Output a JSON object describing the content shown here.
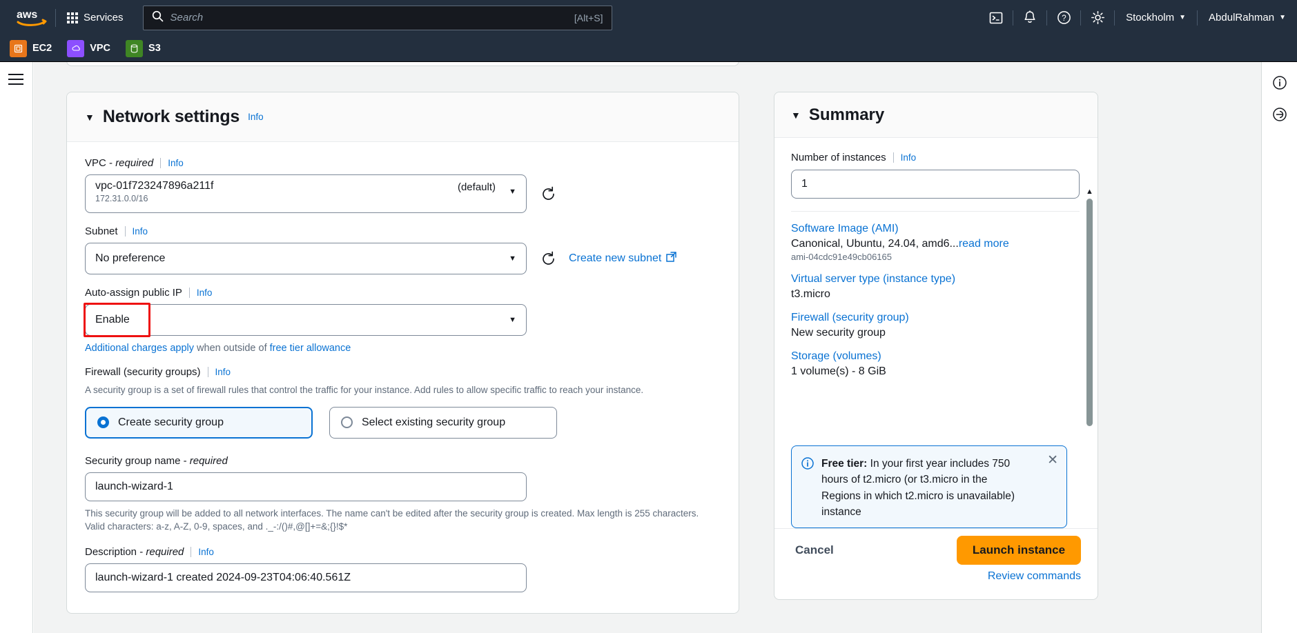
{
  "topnav": {
    "logo_alt": "aws",
    "services_label": "Services",
    "search_placeholder": "Search",
    "search_value": "",
    "search_hint": "[Alt+S]",
    "cloudshell_icon": "cloudshell-icon",
    "notifications_icon": "bell-icon",
    "help_icon": "question-circle-icon",
    "settings_icon": "gear-icon",
    "region": "Stockholm",
    "account": "AbdulRahman",
    "caret": "▼"
  },
  "shortcuts": [
    {
      "label": "EC2",
      "color": "#e8761b",
      "icon": "ec2-icon"
    },
    {
      "label": "VPC",
      "color": "#8c4fff",
      "icon": "vpc-icon"
    },
    {
      "label": "S3",
      "color": "#3f8624",
      "icon": "s3-icon"
    }
  ],
  "left_rail": {
    "menu_icon": "hamburger-menu-icon"
  },
  "right_rail": {
    "info_icon": "info-panel-icon",
    "shortcuts_icon": "shortcuts-panel-icon"
  },
  "network_settings": {
    "title": "Network settings",
    "info_label": "Info",
    "collapse_caret": "▼",
    "vpc": {
      "label": "VPC - ",
      "label_required": "required",
      "info_label": "Info",
      "value": "vpc-01f723247896a211f",
      "suffix": "(default)",
      "cidr": "172.31.0.0/16",
      "refresh_icon": "refresh-icon"
    },
    "subnet": {
      "label": "Subnet",
      "info_label": "Info",
      "value": "No preference",
      "refresh_icon": "refresh-icon",
      "create_link": "Create new subnet",
      "external_icon": "external-link-icon"
    },
    "auto_assign_ip": {
      "label": "Auto-assign public IP",
      "info_label": "Info",
      "value": "Enable",
      "highlighted": true,
      "highlight_color": "#ee1111",
      "charges_link": "Additional charges apply",
      "charges_middle": " when outside of ",
      "charges_link2": "free tier allowance"
    },
    "firewall": {
      "label": "Firewall (security groups)",
      "info_label": "Info",
      "description": "A security group is a set of firewall rules that control the traffic for your instance. Add rules to allow specific traffic to reach your instance.",
      "options": [
        {
          "label": "Create security group",
          "selected": true
        },
        {
          "label": "Select existing security group",
          "selected": false
        }
      ]
    },
    "security_group_name": {
      "label": "Security group name - ",
      "label_required": "required",
      "value": "launch-wizard-1",
      "helper": "This security group will be added to all network interfaces. The name can't be edited after the security group is created. Max length is 255 characters. Valid characters: a-z, A-Z, 0-9, spaces, and ._-:/()#,@[]+=&;{}!$*"
    },
    "description": {
      "label": "Description - ",
      "label_required": "required",
      "info_label": "Info",
      "value": "launch-wizard-1 created 2024-09-23T04:06:40.561Z"
    }
  },
  "summary": {
    "title": "Summary",
    "collapse_caret": "▼",
    "number_of_instances": {
      "label": "Number of instances",
      "info_label": "Info",
      "value": "1"
    },
    "items": [
      {
        "link": "Software Image (AMI)",
        "value": "Canonical, Ubuntu, 24.04, amd6...",
        "value_link": "read more",
        "sub": "ami-04cdc91e49cb06165"
      },
      {
        "link": "Virtual server type (instance type)",
        "value": "t3.micro",
        "value_link": "",
        "sub": ""
      },
      {
        "link": "Firewall (security group)",
        "value": "New security group",
        "value_link": "",
        "sub": ""
      },
      {
        "link": "Storage (volumes)",
        "value": "1 volume(s) - 8 GiB",
        "value_link": "",
        "sub": ""
      }
    ],
    "free_tier": {
      "icon": "info-circle-icon",
      "title": "Free tier:",
      "body": " In your first year includes 750 hours of t2.micro (or t3.micro in the Regions in which t2.micro is unavailable) instance",
      "close_icon": "close-icon"
    },
    "footer": {
      "cancel_label": "Cancel",
      "launch_label": "Launch instance",
      "launch_color": "#ff9900",
      "review_label": "Review commands"
    },
    "scroll_up_icon": "scroll-up-arrow",
    "scroll_down_icon": "scroll-down-arrow"
  }
}
